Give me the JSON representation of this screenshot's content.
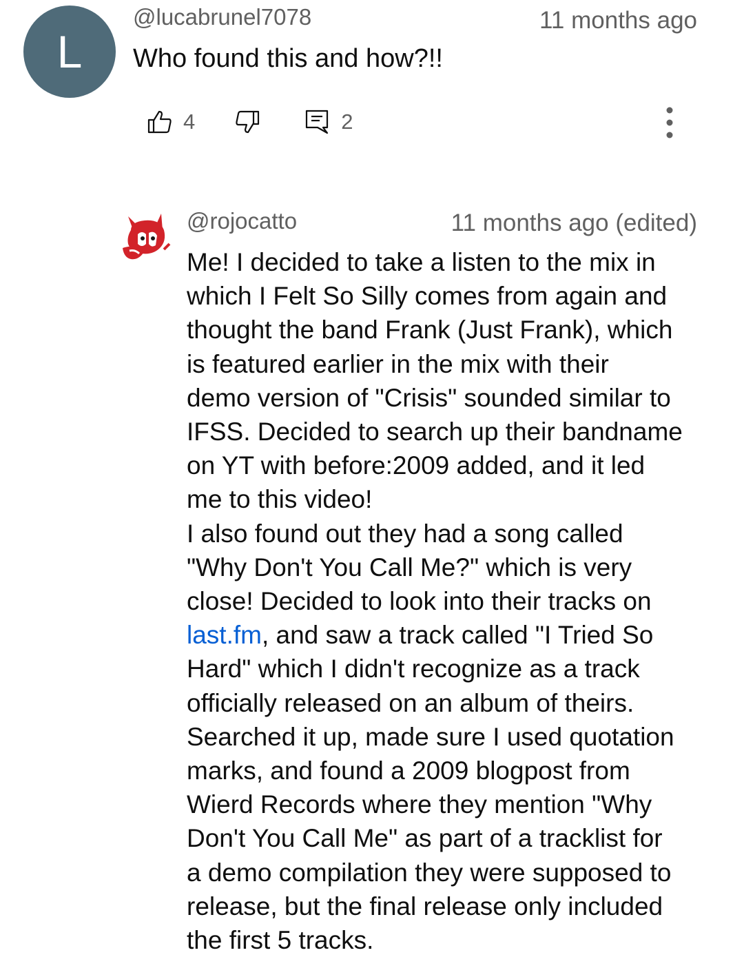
{
  "top_comment": {
    "avatar_letter": "L",
    "avatar_color": "#4f6b79",
    "author": "@lucabrunel7078",
    "time": "11 months ago",
    "text": "Who found this and how?!!",
    "like_count": "4",
    "reply_count": "2",
    "icons": [
      "thumbs-up-icon",
      "thumbs-down-icon",
      "reply-icon",
      "more-vert-icon"
    ]
  },
  "reply": {
    "author": "@rojocatto",
    "time": "11 months ago (edited)",
    "lines": [
      "Me! I decided to take a listen to the mix in",
      "which I Felt So Silly comes from again and",
      "thought the band Frank (Just Frank), which",
      "is featured earlier in the mix with their",
      "demo version of \"Crisis\" sounded similar to",
      "IFSS. Decided to search up their bandname",
      "on YT with before:2009 added, and it led",
      "me to this video!",
      "I also found out they had a song called",
      "\"Why Don't You Call Me?\" which is very",
      "close! Decided to look into their tracks on",
      "LINK_LINE",
      "Hard\" which I didn't recognize as a track",
      "officially released on an album of theirs.",
      "Searched it up, made sure I used quotation",
      "marks, and found a 2009 blogpost from",
      "Wierd Records where they mention \"Why",
      "Don't You Call Me\" as part of a tracklist for",
      "a demo compilation they were supposed to",
      "release, but the final release only included",
      "the first 5 tracks."
    ],
    "link_text": "last.fm",
    "link_line_rest": ", and saw a track called \"I Tried So",
    "link_color": "#065fd4"
  }
}
